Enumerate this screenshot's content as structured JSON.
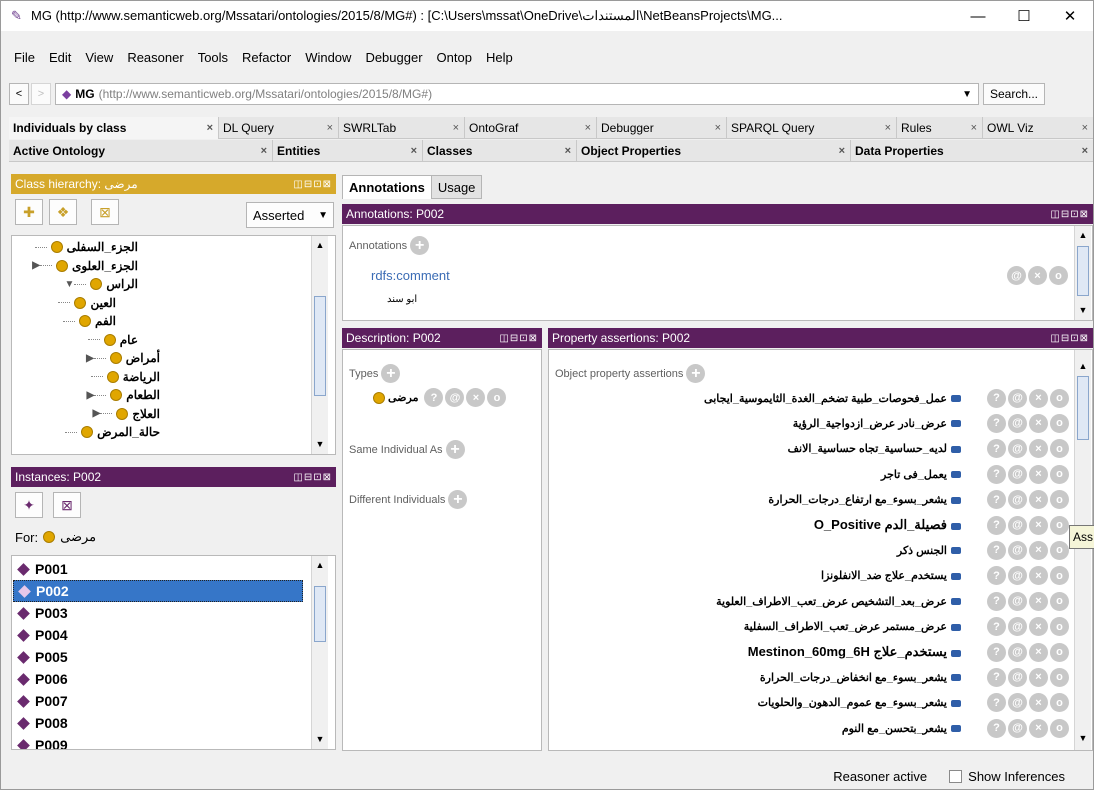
{
  "window": {
    "title": "MG (http://www.semanticweb.org/Mssatari/ontologies/2015/8/MG#) : [C:\\Users\\mssat\\OneDrive\\المستندات\\NetBeansProjects\\MG...",
    "minimize": "—",
    "maximize": "☐",
    "close": "✕"
  },
  "menu": [
    "File",
    "Edit",
    "View",
    "Reasoner",
    "Tools",
    "Refactor",
    "Window",
    "Debugger",
    "Ontop",
    "Help"
  ],
  "urlbar": {
    "back": "<",
    "forward": ">",
    "label": "MG",
    "iri": "(http://www.semanticweb.org/Mssatari/ontologies/2015/8/MG#)",
    "dropdown": "▼",
    "search": "Search..."
  },
  "tabs_row1": [
    {
      "label": "Individuals by class",
      "active": true
    },
    {
      "label": "DL Query"
    },
    {
      "label": "SWRLTab"
    },
    {
      "label": "OntoGraf"
    },
    {
      "label": "Debugger"
    },
    {
      "label": "SPARQL Query"
    },
    {
      "label": "Rules"
    },
    {
      "label": "OWL Viz"
    }
  ],
  "tabs_row2": [
    {
      "label": "Active Ontology"
    },
    {
      "label": "Entities"
    },
    {
      "label": "Classes"
    },
    {
      "label": "Object Properties"
    },
    {
      "label": "Data Properties"
    }
  ],
  "tab_close": "×",
  "class_hierarchy": {
    "title": "Class hierarchy: مرضى",
    "asserted": "Asserted",
    "items": [
      {
        "label": "الجزء_السفلى",
        "indent": 3,
        "expand": ""
      },
      {
        "label": "الجزء_العلوى",
        "indent": 3,
        "expand": "▶"
      },
      {
        "label": "الراس",
        "indent": 3,
        "expand": "▼"
      },
      {
        "label": "العين",
        "indent": 4,
        "expand": ""
      },
      {
        "label": "الفم",
        "indent": 4,
        "expand": ""
      },
      {
        "label": "عام",
        "indent": 3,
        "expand": ""
      },
      {
        "label": "أمراض",
        "indent": 2,
        "expand": "▶"
      },
      {
        "label": "الرياضة",
        "indent": 2,
        "expand": ""
      },
      {
        "label": "الطعام",
        "indent": 2,
        "expand": "▶"
      },
      {
        "label": "العلاج",
        "indent": 2,
        "expand": "▶"
      },
      {
        "label": "حالة_المرض",
        "indent": 2,
        "expand": ""
      }
    ]
  },
  "instances": {
    "title": "Instances: P002",
    "for_label": "For:",
    "for_class": "مرضى",
    "items": [
      "P001",
      "P002",
      "P003",
      "P004",
      "P005",
      "P006",
      "P007",
      "P008",
      "P009"
    ],
    "selected": "P002"
  },
  "annot_tabs": [
    "Annotations",
    "Usage"
  ],
  "annotations": {
    "title": "Annotations: P002",
    "section": "Annotations",
    "property": "rdfs:comment",
    "value": "ابو سند"
  },
  "description": {
    "title": "Description: P002",
    "types": "Types",
    "type_value": "مرضى",
    "same": "Same Individual As",
    "different": "Different Individuals"
  },
  "property_assertions": {
    "title": "Property assertions: P002",
    "section": "Object property assertions",
    "items": [
      "عمل_فحوصات_طبية  تضخم_الغدة_الثايموسية_ايجابى",
      "عرض_نادر  عرض_ازدواجية_الرؤية",
      "لديه_حساسية_تجاه  حساسية_الانف",
      "يعمل_فى  تاجر",
      "يشعر_بسوء_مع  ارتفاع_درجات_الحرارة",
      "فصيلة_الدم  O_Positive",
      "الجنس  ذكر",
      "يستخدم_علاج  ضد_الانفلونزا",
      "عرض_بعد_التشخيص  عرض_تعب_الاطراف_العلوية",
      "عرض_مستمر  عرض_تعب_الاطراف_السفلية",
      "يستخدم_علاج  Mestinon_60mg_6H",
      "يشعر_بسوء_مع  انخفاض_درجات_الحرارة",
      "يشعر_بسوء_مع  عموم_الدهون_والحلويات",
      "يشعر_بتحسن_مع  النوم"
    ],
    "tooltip": "Ass"
  },
  "button_glyphs": {
    "help": "?",
    "annot": "@",
    "remove": "×",
    "edit": "o",
    "add": "+"
  },
  "panel_controls": "◫⊟⊡⊠",
  "status": {
    "reasoner": "Reasoner active",
    "inferences": "Show Inferences"
  },
  "colors": {
    "purple_header": "#5c1f5e",
    "gold_header": "#d6a92b",
    "selection": "#3676c8",
    "class_dot": "#e0a600",
    "individual": "#6a2a6e"
  }
}
